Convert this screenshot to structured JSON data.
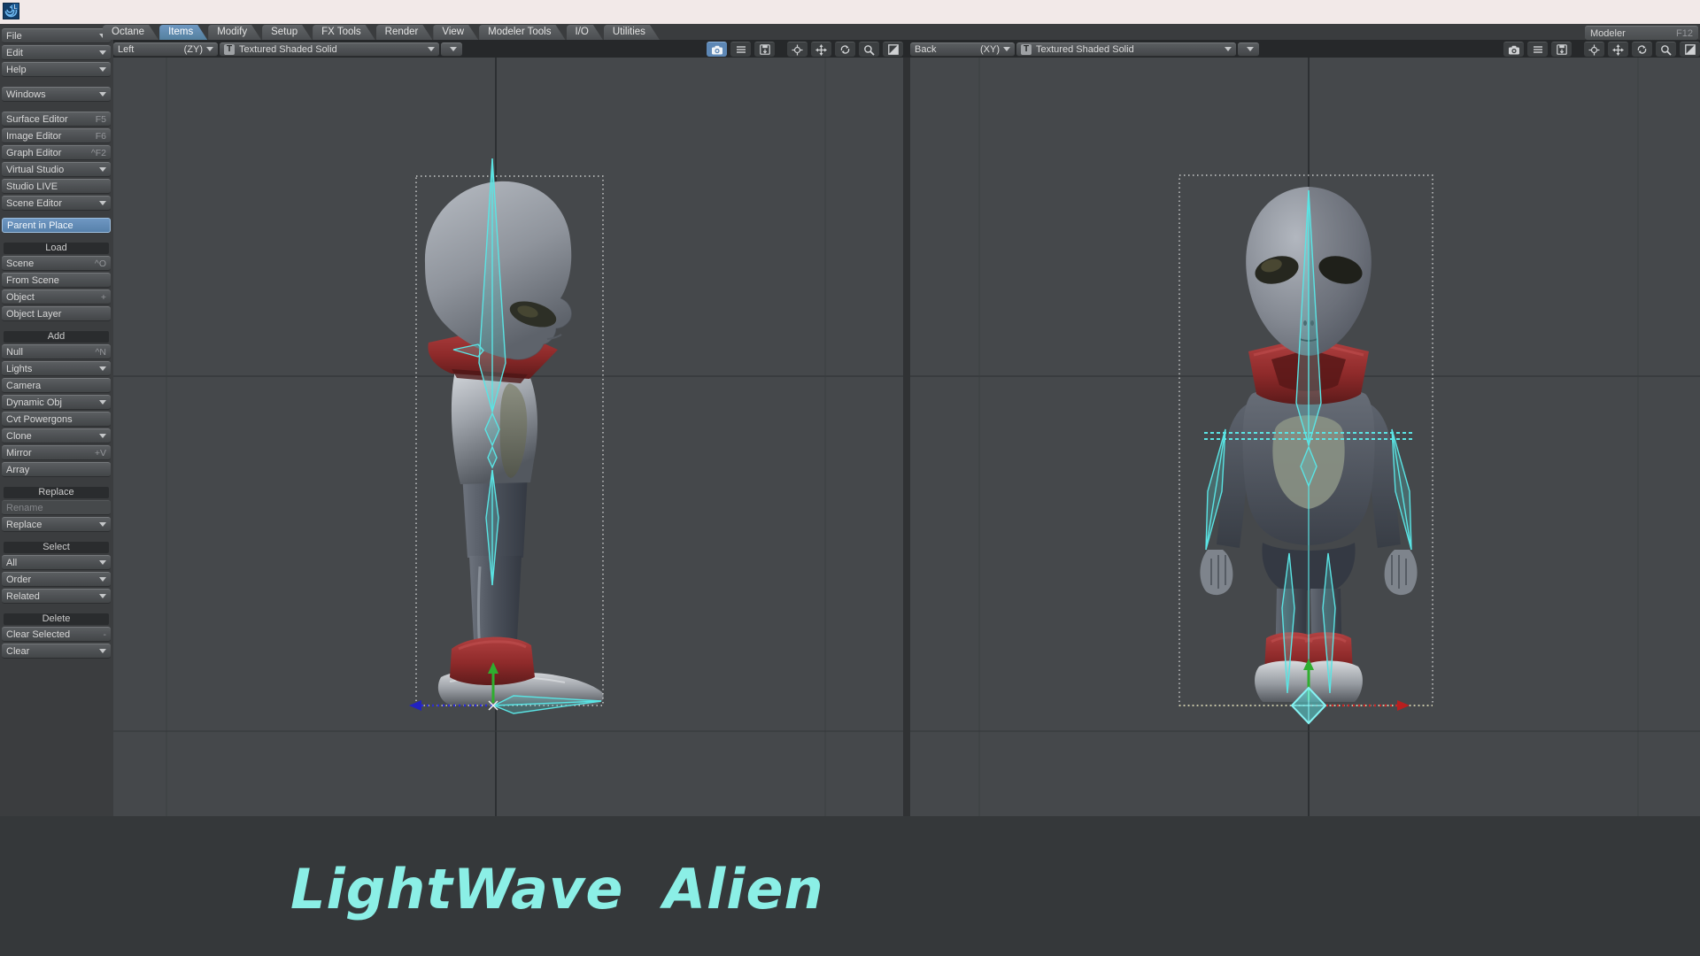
{
  "tabs": {
    "items": [
      "Octane",
      "Items",
      "Modify",
      "Setup",
      "FX Tools",
      "Render",
      "View",
      "Modeler Tools",
      "I/O",
      "Utilities"
    ],
    "active": "Items",
    "modeler_label": "Modeler",
    "modeler_shortcut": "F12"
  },
  "sidebar": {
    "menus": [
      {
        "label": "File"
      },
      {
        "label": "Edit"
      },
      {
        "label": "Help"
      }
    ],
    "windows_menu": {
      "label": "Windows"
    },
    "editors": [
      {
        "label": "Surface Editor",
        "shortcut": "F5"
      },
      {
        "label": "Image Editor",
        "shortcut": "F6"
      },
      {
        "label": "Graph Editor",
        "shortcut": "^F2"
      },
      {
        "label": "Virtual Studio"
      },
      {
        "label": "Studio LIVE"
      },
      {
        "label": "Scene Editor"
      }
    ],
    "parent_in_place": {
      "label": "Parent in Place",
      "active": true
    },
    "sections": [
      {
        "title": "Load",
        "items": [
          {
            "label": "Scene",
            "shortcut": "^O"
          },
          {
            "label": "From Scene"
          },
          {
            "label": "Object",
            "shortcut": "+"
          },
          {
            "label": "Object Layer"
          }
        ]
      },
      {
        "title": "Add",
        "items": [
          {
            "label": "Null",
            "shortcut": "^N"
          },
          {
            "label": "Lights"
          },
          {
            "label": "Camera"
          },
          {
            "label": "Dynamic Obj"
          },
          {
            "label": "Cvt Powergons"
          },
          {
            "label": "Clone"
          },
          {
            "label": "Mirror",
            "shortcut": "+V"
          },
          {
            "label": "Array"
          }
        ]
      },
      {
        "title": "Replace",
        "items": [
          {
            "label": "Rename",
            "disabled": true
          },
          {
            "label": "Replace"
          }
        ]
      },
      {
        "title": "Select",
        "items": [
          {
            "label": "All"
          },
          {
            "label": "Order"
          },
          {
            "label": "Related"
          }
        ]
      },
      {
        "title": "Delete",
        "items": [
          {
            "label": "Clear Selected",
            "shortcut": "-"
          },
          {
            "label": "Clear"
          }
        ]
      }
    ]
  },
  "viewports": [
    {
      "name": "Left",
      "axes": "(ZY)",
      "mode": "Textured Shaded Solid",
      "mode_icon": "T"
    },
    {
      "name": "Back",
      "axes": "(XY)",
      "mode": "Textured Shaded Solid",
      "mode_icon": "T"
    }
  ],
  "caption": {
    "text": "LightWave Alien",
    "color": "#8BEFE6"
  },
  "colors": {
    "accent_blue": "#5d87b5",
    "viewport_bg": "#45484b",
    "bone_cyan": "#5ae4e4",
    "collar_red": "#8e2a2a",
    "caption_cyan": "#8BEFE6",
    "title_strip_pink": "#f2e9e8"
  }
}
